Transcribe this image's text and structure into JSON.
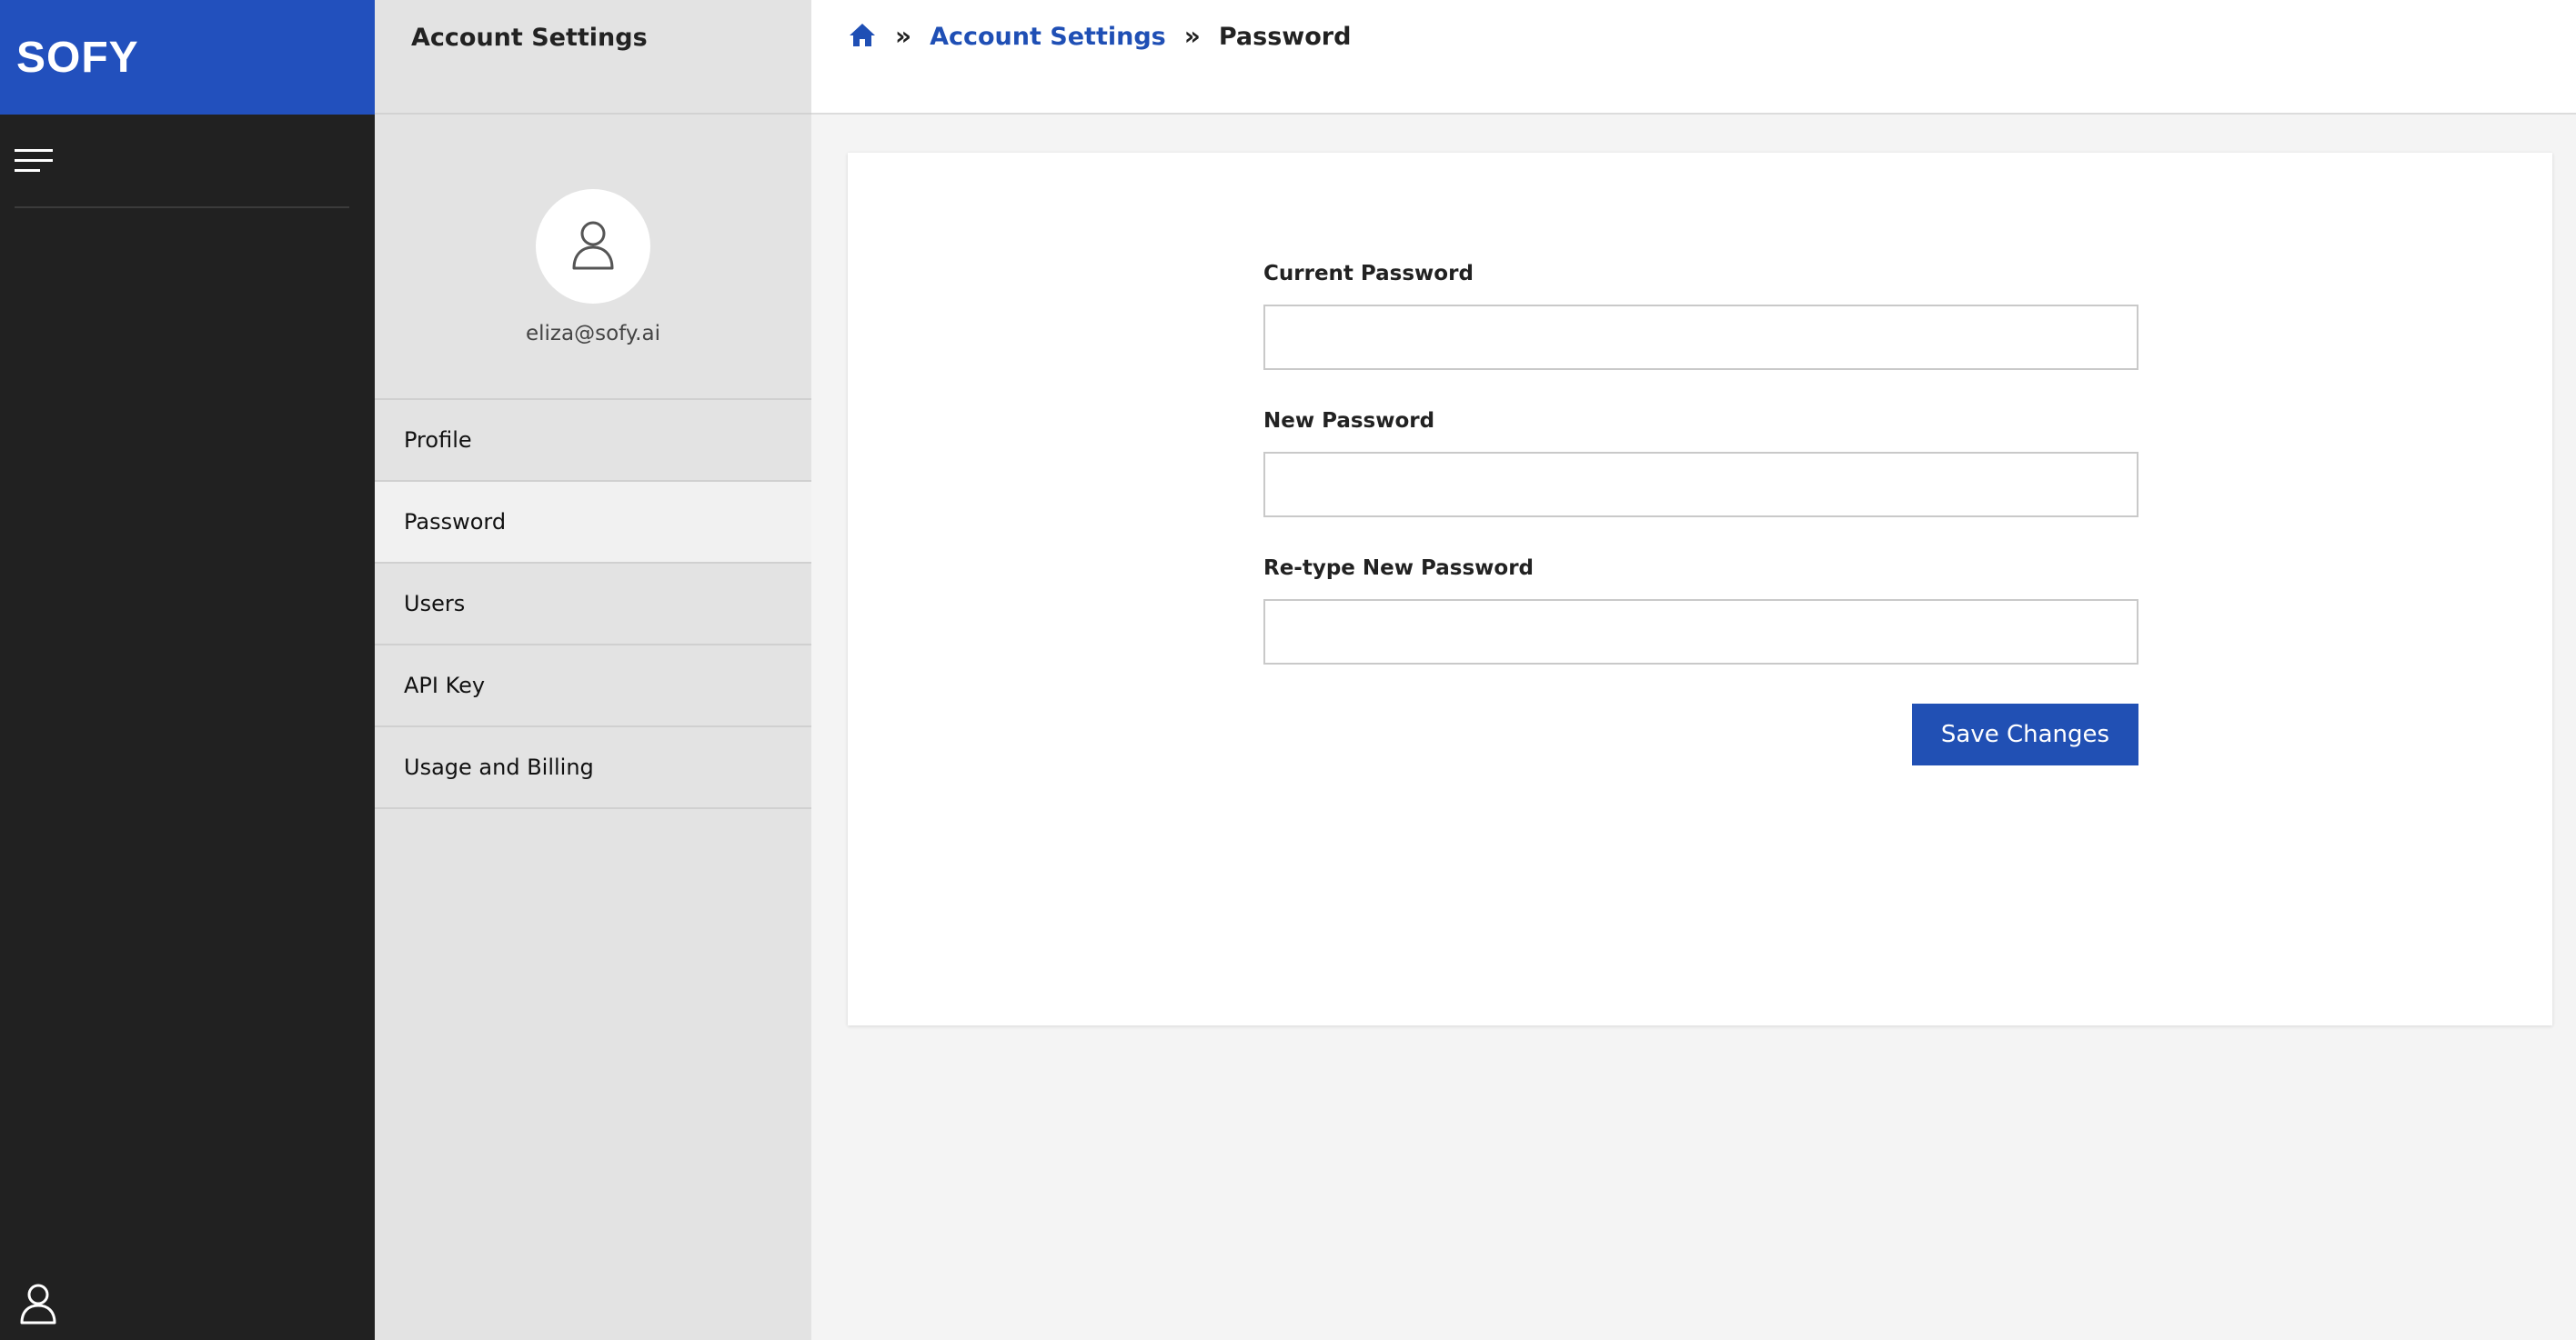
{
  "brand": {
    "logo_text": "SOFY",
    "color": "#2250bd"
  },
  "sidebar": {
    "menu_icon": "hamburger-menu-icon",
    "user_icon": "user-icon"
  },
  "settings_panel": {
    "title": "Account Settings",
    "avatar_icon": "user-icon",
    "email": "eliza@sofy.ai",
    "nav": [
      {
        "label": "Profile",
        "active": false
      },
      {
        "label": "Password",
        "active": true
      },
      {
        "label": "Users",
        "active": false
      },
      {
        "label": "API Key",
        "active": false
      },
      {
        "label": "Usage and Billing",
        "active": false
      }
    ]
  },
  "breadcrumb": {
    "home_icon": "home-icon",
    "separator_icon": "double-chevron-right-icon",
    "items": [
      "Account Settings",
      "Password"
    ]
  },
  "form": {
    "fields": [
      {
        "label": "Current Password",
        "value": "",
        "placeholder": ""
      },
      {
        "label": "New Password",
        "value": "",
        "placeholder": ""
      },
      {
        "label": "Re-type New Password",
        "value": "",
        "placeholder": ""
      }
    ],
    "save_label": "Save Changes",
    "accent_color": "#2150b4"
  }
}
